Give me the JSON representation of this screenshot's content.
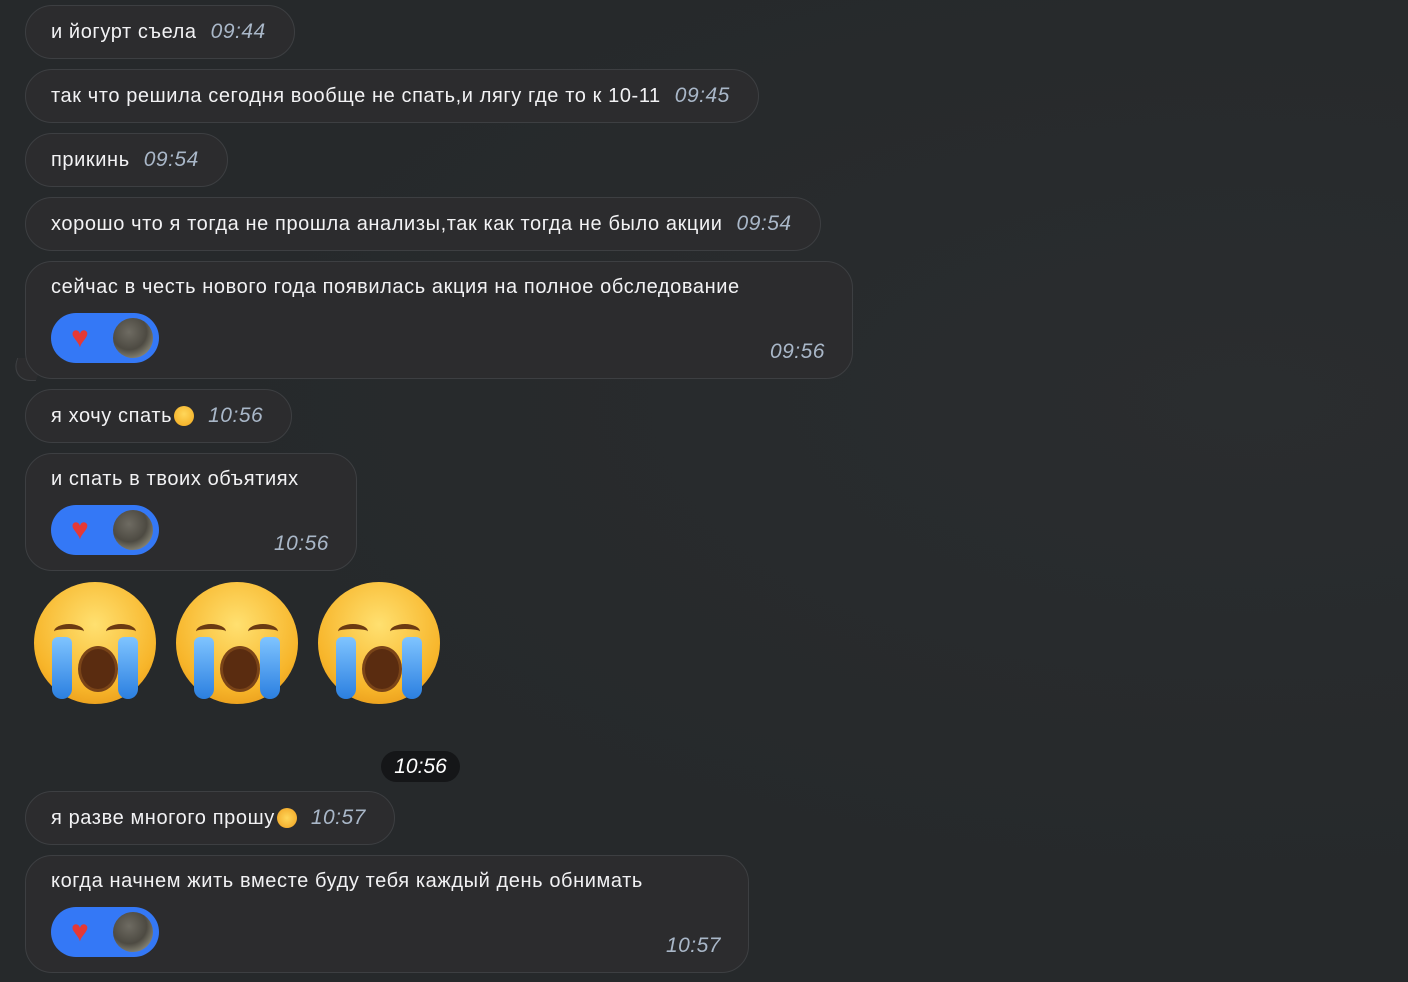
{
  "messages": [
    {
      "text": "и йогурт съела",
      "time": "09:44"
    },
    {
      "text": "так что решила сегодня вообще не спать,и лягу где то к 10-11",
      "time": "09:45"
    },
    {
      "text": "прикинь",
      "time": "09:54"
    },
    {
      "text": "хорошо что я тогда не прошла анализы,так как тогда не было акции",
      "time": "09:54"
    },
    {
      "text": "сейчас в честь нового года появилась акция на полное обследование",
      "time": "09:56",
      "reaction": "heart"
    },
    {
      "text": "я хочу спать",
      "emoji": "loudly-crying-face",
      "time": "10:56"
    },
    {
      "text": "и спать в твоих объятиях",
      "time": "10:56",
      "reaction": "heart"
    },
    {
      "big_emoji": [
        "loudly-crying-face",
        "loudly-crying-face",
        "loudly-crying-face"
      ],
      "time": "10:56"
    },
    {
      "text": "я разве многого прошу",
      "emoji": "woozy-face",
      "time": "10:57"
    },
    {
      "text": "когда начнем жить вместе буду тебя каждый день обнимать",
      "time": "10:57",
      "reaction": "heart"
    }
  ],
  "reaction_icon": "♥",
  "colors": {
    "background": "#26292b",
    "bubble": "#2c2c2e",
    "reaction": "#3478f6",
    "time": "#a9b7c8"
  }
}
